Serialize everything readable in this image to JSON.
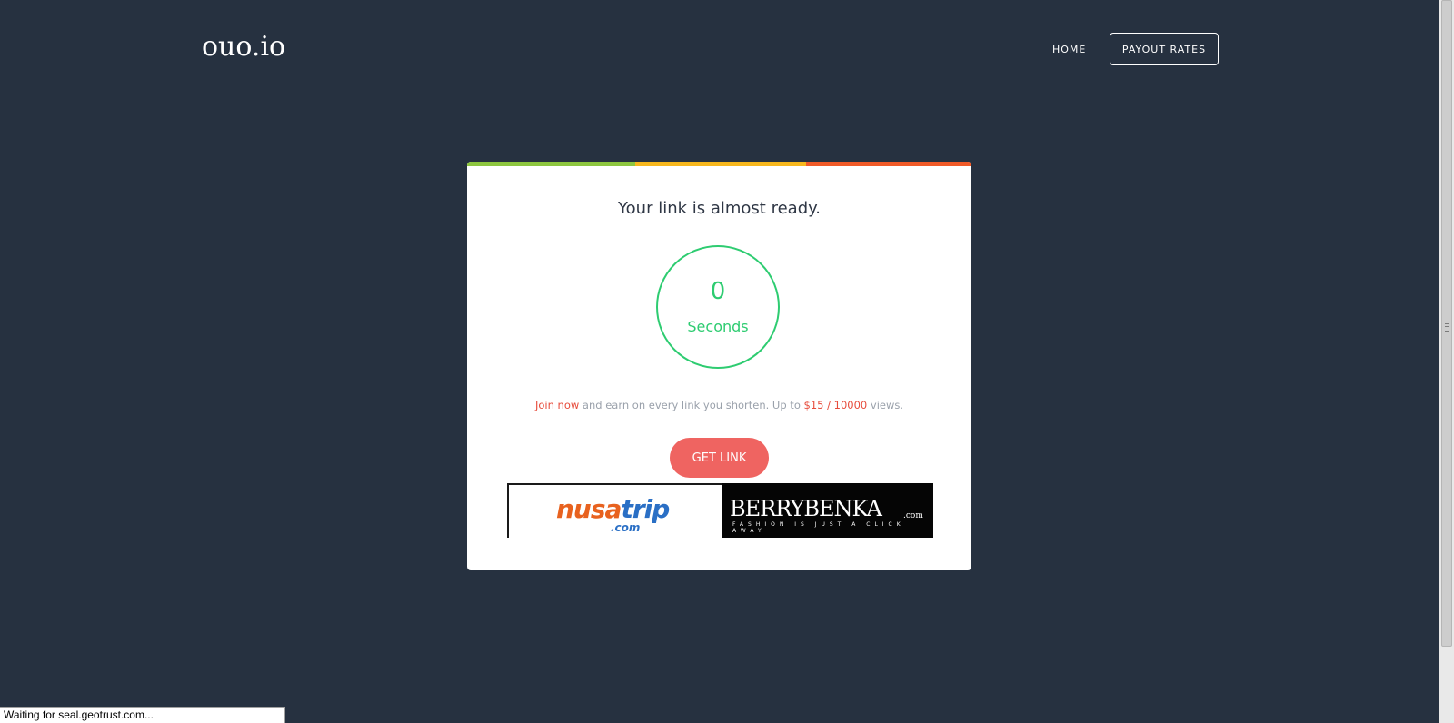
{
  "header": {
    "logo": "ouo.io",
    "nav": {
      "home_label": "HOME",
      "payout_label": "PAYOUT RATES"
    }
  },
  "card": {
    "top_bar_colors": [
      "#8dc63f",
      "#f7b71d",
      "#f05a28"
    ],
    "title": "Your link is almost ready.",
    "timer": {
      "value": "0",
      "unit": "Seconds",
      "color": "#2ecc71"
    },
    "promo": {
      "join_link": "Join now",
      "middle_text": " and earn on every link you shorten. Up to ",
      "rate": "$15 / 10000",
      "end_text": " views."
    },
    "get_link_label": "GET LINK",
    "ads": {
      "nusatrip": {
        "brand_part1": "nusa",
        "brand_part2": "trip",
        "dotcom": ".com"
      },
      "berrybenka": {
        "brand": "BERRYBENKA",
        "dotcom": ".com",
        "tagline": "FASHION IS JUST A CLICK AWAY"
      }
    }
  },
  "status_bar": {
    "text": "Waiting for seal.geotrust.com..."
  },
  "colors": {
    "background": "#263140",
    "accent_red": "#e74c3c",
    "button": "#ef6461"
  }
}
